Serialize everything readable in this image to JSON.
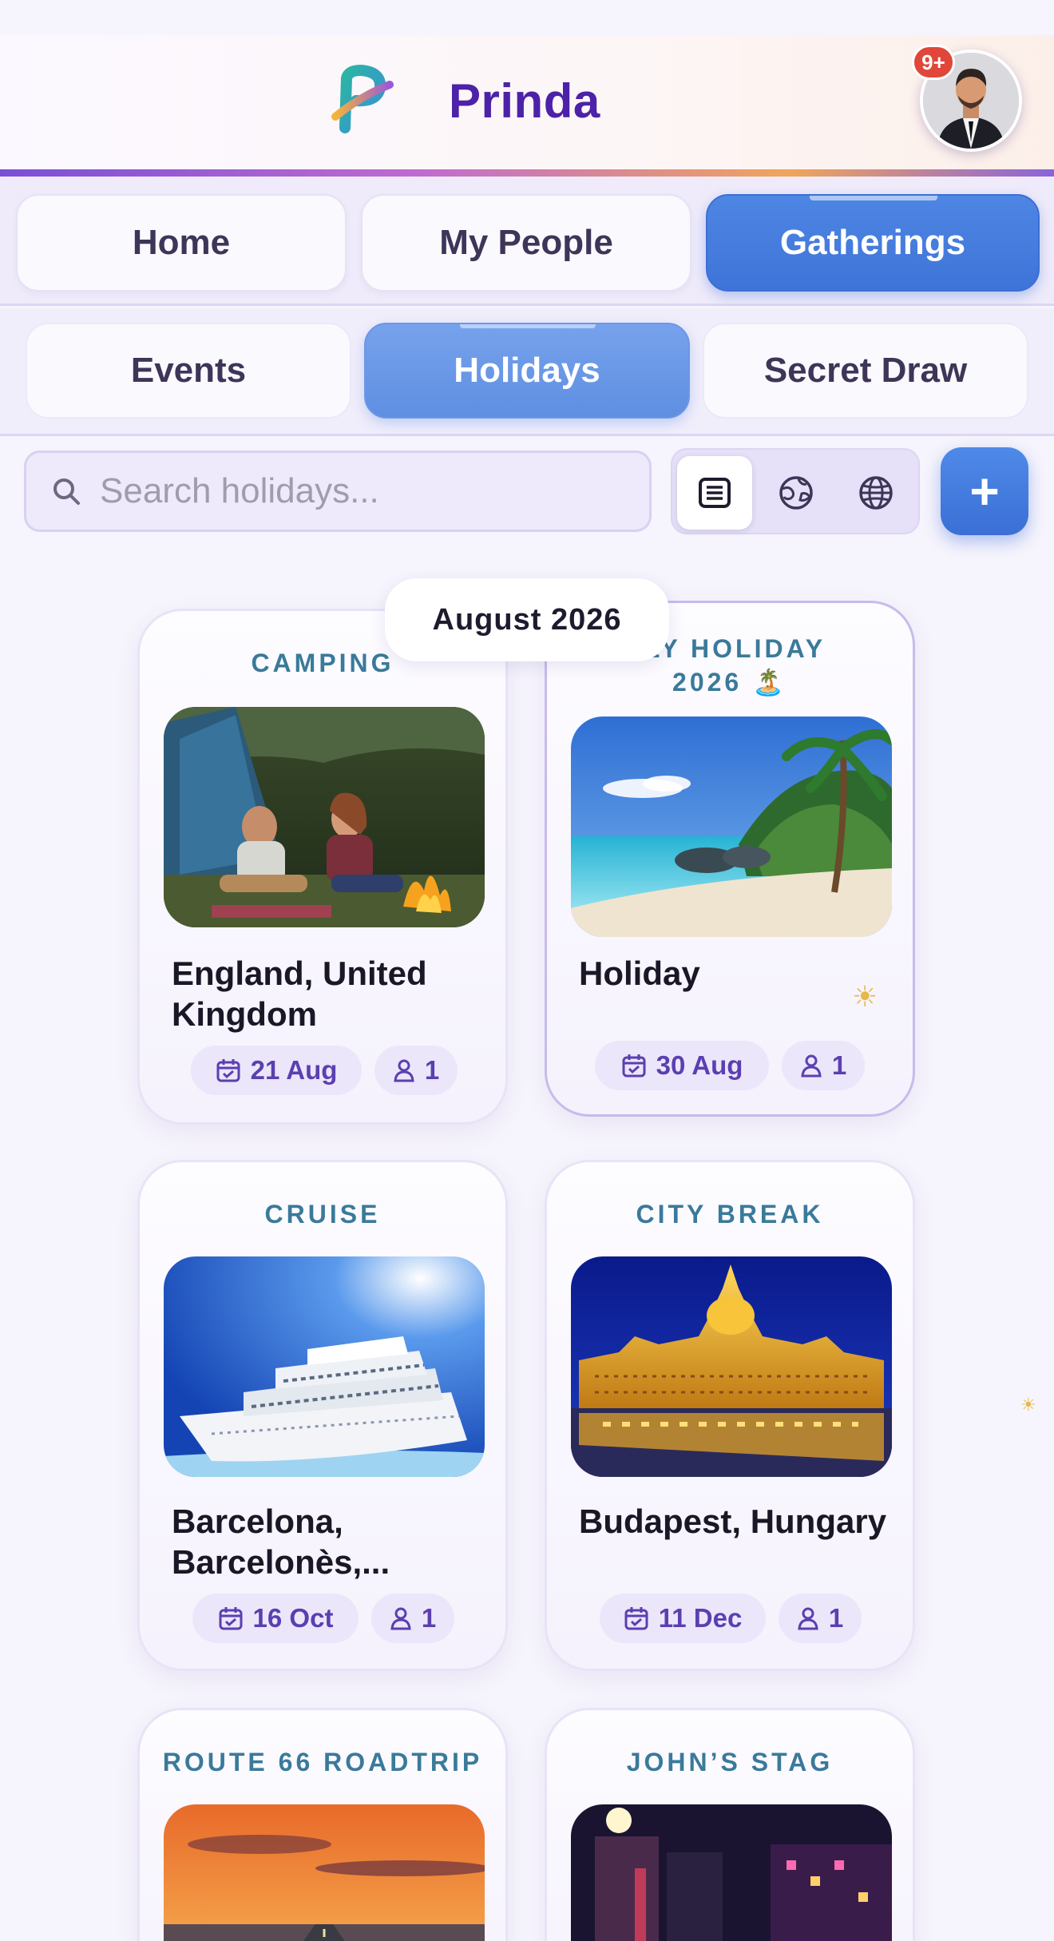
{
  "app": {
    "title": "Prinda",
    "notification_count": "9+"
  },
  "primary_tabs": [
    {
      "label": "Home",
      "active": false
    },
    {
      "label": "My People",
      "active": false
    },
    {
      "label": "Gatherings",
      "active": true
    }
  ],
  "secondary_tabs": [
    {
      "label": "Events",
      "active": false
    },
    {
      "label": "Holidays",
      "active": true
    },
    {
      "label": "Secret Draw",
      "active": false
    }
  ],
  "search": {
    "placeholder": "Search holidays...",
    "value": ""
  },
  "view_modes": [
    {
      "icon": "list-icon",
      "active": true
    },
    {
      "icon": "map-globe-icon",
      "active": false
    },
    {
      "icon": "globe-icon",
      "active": false
    }
  ],
  "add_button": {
    "label": "+"
  },
  "month_header": "August 2026",
  "cards": [
    {
      "category": "CAMPING",
      "name": "England, United Kingdom",
      "date": "21 Aug",
      "people": "1",
      "photo": "camping-photo"
    },
    {
      "category": "FAMILY HOLIDAY 2026 🏝️",
      "category_visible": "ILY HOLIDAY",
      "category_line2": "2026 🏝️",
      "name": "Holiday",
      "date": "30 Aug",
      "people": "1",
      "photo": "beach-photo"
    },
    {
      "category": "CRUISE",
      "name": "Barcelona, Barcelonès,...",
      "date": "16 Oct",
      "people": "1",
      "photo": "cruise-ship-photo"
    },
    {
      "category": "CITY BREAK",
      "name": "Budapest, Hungary",
      "date": "11 Dec",
      "people": "1",
      "photo": "parliament-photo"
    },
    {
      "category": "ROUTE 66 ROADTRIP",
      "name": "",
      "date": "",
      "people": "",
      "photo": "sunset-road-photo"
    },
    {
      "category": "JOHN’S STAG",
      "name": "",
      "date": "",
      "people": "",
      "photo": "night-city-photo"
    }
  ],
  "colors": {
    "brand_purple": "#4b22a8",
    "active_tab_blue": "#3e74d8",
    "category_teal": "#3a7a9a",
    "pill_text": "#5b3fb0"
  }
}
